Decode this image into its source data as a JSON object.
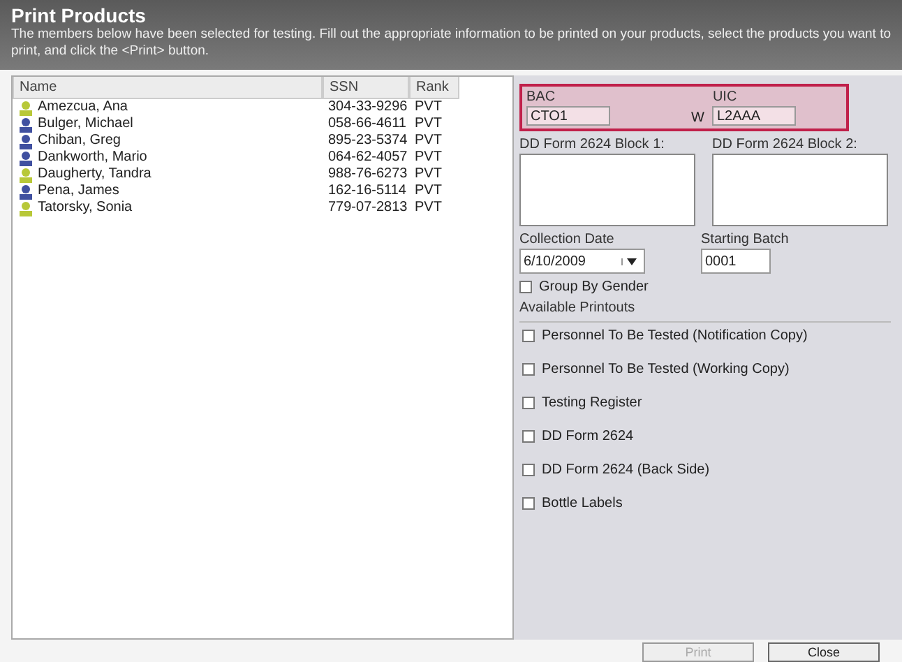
{
  "header": {
    "title": "Print Products",
    "description": "The members below have been selected for testing.  Fill out the appropriate information to be printed on your products, select the products you want to print, and click the <Print> button."
  },
  "table": {
    "columns": [
      "Name",
      "SSN",
      "Rank"
    ],
    "rows": [
      {
        "kind": "female",
        "name": "Amezcua, Ana",
        "ssn": "304-33-9296",
        "rank": "PVT"
      },
      {
        "kind": "male",
        "name": "Bulger, Michael",
        "ssn": "058-66-4611",
        "rank": "PVT"
      },
      {
        "kind": "male",
        "name": "Chiban, Greg",
        "ssn": "895-23-5374",
        "rank": "PVT"
      },
      {
        "kind": "male",
        "name": "Dankworth, Mario",
        "ssn": "064-62-4057",
        "rank": "PVT"
      },
      {
        "kind": "female",
        "name": "Daugherty, Tandra",
        "ssn": "988-76-6273",
        "rank": "PVT"
      },
      {
        "kind": "male",
        "name": "Pena, James",
        "ssn": "162-16-5114",
        "rank": "PVT"
      },
      {
        "kind": "female",
        "name": "Tatorsky, Sonia",
        "ssn": "779-07-2813",
        "rank": "PVT"
      }
    ]
  },
  "form": {
    "bac": {
      "label": "BAC",
      "value": "CTO1"
    },
    "uic": {
      "label": "UIC",
      "prefix": "W",
      "value": "L2AAA"
    },
    "block1": {
      "label": "DD Form 2624 Block 1:"
    },
    "block2": {
      "label": "DD Form 2624 Block 2:"
    },
    "collection_date": {
      "label": "Collection Date",
      "value": "6/10/2009"
    },
    "starting_batch": {
      "label": "Starting Batch",
      "value": "0001"
    },
    "group_by_gender": {
      "label": "Group By Gender",
      "checked": false
    },
    "printouts_label": "Available Printouts",
    "printouts": [
      {
        "label": "Personnel To Be Tested (Notification Copy)",
        "checked": false
      },
      {
        "label": "Personnel To Be Tested (Working Copy)",
        "checked": false
      },
      {
        "label": "Testing Register",
        "checked": false
      },
      {
        "label": "DD Form 2624",
        "checked": false
      },
      {
        "label": "DD Form 2624 (Back Side)",
        "checked": false
      },
      {
        "label": "Bottle Labels",
        "checked": false
      }
    ]
  },
  "buttons": [
    {
      "label": "Print",
      "disabled": true
    },
    {
      "label": "Close",
      "disabled": false
    }
  ]
}
